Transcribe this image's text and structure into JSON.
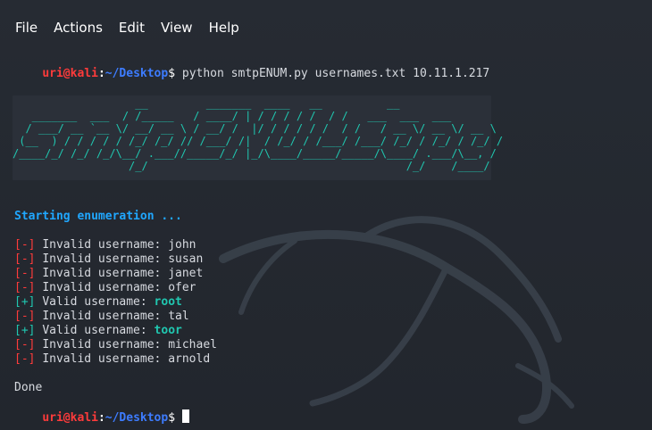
{
  "menu": {
    "items": [
      "File",
      "Actions",
      "Edit",
      "View",
      "Help"
    ]
  },
  "prompt": {
    "user": "uri",
    "at": "@",
    "host": "kali",
    "colon": ":",
    "path": "~/Desktop",
    "dollar": "$"
  },
  "command": "python smtpENUM.py usernames.txt 10.11.1.217",
  "banner": {
    "lines": [
      "                   __         _______  ____   __          __",
      "   _______  ___  / /_____   / ____/ | / / / / /  / /   ___  ___  ___",
      "  / ___/ __ `__ \\/ __/ __ \\ / __/ /  |/ / / / / /  / /   / __ \\/ __ \\/ __ \\",
      " (__  ) / / / / / /_/ /_/ // /___/ /|  / /_/ / /___/ /___/ /_/ / /_/ / /_/ /",
      "/____/_/ /_/ /_/\\__/ .___//_____/_/ |_/\\____/_____/_____/\\____/ .___/\\__, /",
      "                  /_/                                        /_/    /____/"
    ]
  },
  "status": {
    "starting": "Starting enumeration ..."
  },
  "results": [
    {
      "mark": "[-]",
      "text": "Invalid username: ",
      "name": "john",
      "valid": false
    },
    {
      "mark": "[-]",
      "text": "Invalid username: ",
      "name": "susan",
      "valid": false
    },
    {
      "mark": "[-]",
      "text": "Invalid username: ",
      "name": "janet",
      "valid": false
    },
    {
      "mark": "[-]",
      "text": "Invalid username: ",
      "name": "ofer",
      "valid": false
    },
    {
      "mark": "[+]",
      "text": "Valid username: ",
      "name": "root",
      "valid": true
    },
    {
      "mark": "[-]",
      "text": "Invalid username: ",
      "name": "tal",
      "valid": false
    },
    {
      "mark": "[+]",
      "text": "Valid username: ",
      "name": "toor",
      "valid": true
    },
    {
      "mark": "[-]",
      "text": "Invalid username: ",
      "name": "michael",
      "valid": false
    },
    {
      "mark": "[-]",
      "text": "Invalid username: ",
      "name": "arnold",
      "valid": false
    }
  ],
  "done": "Done",
  "colors": {
    "background": "#23272f",
    "red": "#ff3b3b",
    "path_blue": "#3d7cff",
    "teal": "#20c7b0",
    "status_blue": "#20a7ff"
  },
  "icons": [
    "kali-dragon-watermark"
  ]
}
